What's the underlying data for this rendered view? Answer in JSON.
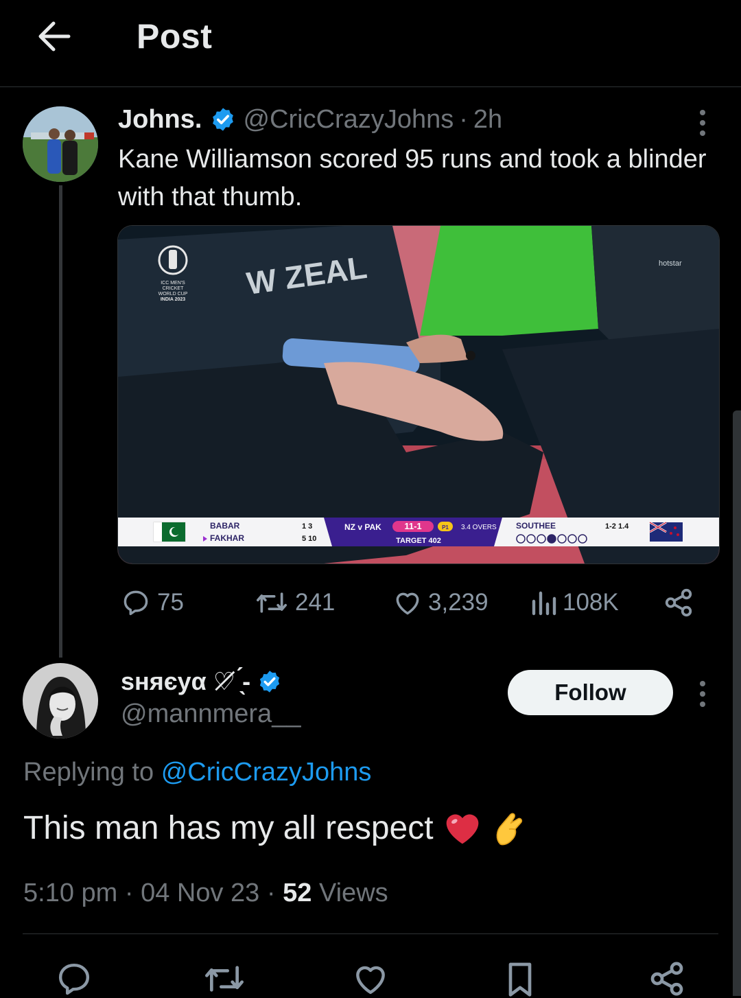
{
  "header": {
    "title": "Post",
    "back_icon": "back-arrow-icon"
  },
  "parent_tweet": {
    "display_name": "Johns.",
    "handle": "@CricCrazyJohns",
    "separator": "·",
    "time": "2h",
    "text": "Kane Williamson scored 95 runs and took a blinder with that thumb.",
    "media": {
      "logo_lines": [
        "ICC MEN'S",
        "CRICKET",
        "WORLD CUP",
        "INDIA 2023"
      ],
      "jersey_text": "W ZEAL",
      "broadcaster": "hotstar",
      "score_bar": {
        "batter1": "BABAR",
        "batter1_stats": "1  3",
        "batter2": "FAKHAR",
        "batter2_stats": "5  10",
        "match": "NZ v PAK",
        "score": "11-1",
        "phase": "P1",
        "overs": "3.4 OVERS",
        "target": "TARGET 402",
        "bowler": "SOUTHEE",
        "bowler_stats": "1-2  1.4"
      }
    },
    "stats": {
      "replies": "75",
      "reposts": "241",
      "likes": "3,239",
      "views": "108K"
    }
  },
  "reply": {
    "display_name": "sʜяєуα ♡̸ ̖́-",
    "handle": "@mannmera__",
    "follow_label": "Follow",
    "replying_prefix": "Replying to",
    "replying_handle": "@CricCrazyJohns",
    "text": "This man has my all respect",
    "emojis": [
      "red-heart-emoji",
      "pinching-hand-emoji"
    ],
    "time": "5:10 pm",
    "date": "04 Nov 23",
    "views_count": "52",
    "views_label": "Views",
    "separator": "·"
  },
  "colors": {
    "accent": "#1d9bf0",
    "muted": "#71767b",
    "background": "#000000",
    "text": "#e7e9ea"
  }
}
